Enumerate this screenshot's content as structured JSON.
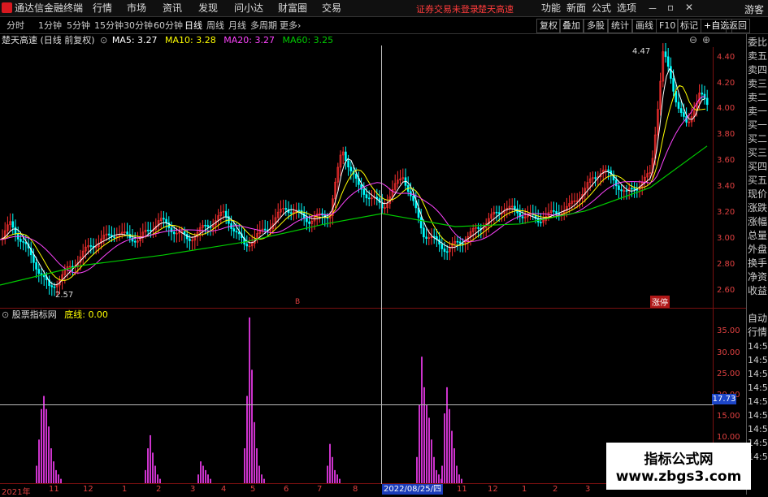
{
  "menu": {
    "app_name": "通达信金融终端",
    "items": [
      "行情",
      "市场",
      "资讯",
      "发现",
      "问小达",
      "财富圈",
      "交易"
    ],
    "trade_status": "证券交易未登录",
    "trade_status2": "楚天高速",
    "right_items": [
      "功能",
      "新面",
      "公式",
      "选项"
    ],
    "guest": "游客"
  },
  "toolbar": {
    "periods": [
      "分时",
      "1分钟",
      "5分钟",
      "15分钟",
      "30分钟",
      "60分钟",
      "日线",
      "周线",
      "月线",
      "多周期",
      "更多"
    ],
    "active_period": "日线",
    "buttons": [
      "复权",
      "叠加",
      "多股",
      "统计",
      "画线",
      "F10",
      "标记",
      "+自选",
      "返回"
    ]
  },
  "info": {
    "stock": "楚天高速",
    "mode": "(日线 前复权)",
    "ma5": "MA5: 3.27",
    "ma10": "MA10: 3.28",
    "ma20": "MA20: 3.27",
    "ma60": "MA60: 3.25"
  },
  "price_axis": [
    "4.40",
    "4.20",
    "4.00",
    "3.80",
    "3.60",
    "3.40",
    "3.20",
    "3.00",
    "2.80",
    "2.60"
  ],
  "high_label": "4.47",
  "low_label": "2.57",
  "marker_b": "B",
  "label_zhangting": "涨停",
  "indicator": {
    "title": "股票指标网",
    "line_name": "底线:",
    "line_value": "0.00",
    "axis": [
      "35.00",
      "30.00",
      "25.00",
      "20.00",
      "15.00",
      "10.00"
    ],
    "value_tag": "17.73"
  },
  "right_panel": {
    "top_labels": [
      "委比",
      "卖五",
      "卖四",
      "卖三",
      "卖二",
      "卖一",
      "买一",
      "买二",
      "买三",
      "买四",
      "买五",
      "现价",
      "涨跌",
      "涨幅",
      "总量",
      "外盘",
      "换手",
      "净资",
      "收益"
    ],
    "bottom_labels": [
      "自动",
      "行情",
      "14:50",
      "14:50",
      "14:50",
      "14:50",
      "14:50",
      "14:50",
      "14:50",
      "14:50",
      "14:50"
    ]
  },
  "dates": {
    "labels": [
      "2021年",
      "11",
      "12",
      "1",
      "2",
      "3",
      "4",
      "5",
      "6",
      "7",
      "8",
      "9",
      "10",
      "11",
      "12",
      "1",
      "2",
      "3"
    ],
    "cursor": "2022/08/25/四"
  },
  "watermark": {
    "title": "指标公式网",
    "url": "www.zbgs3.com"
  },
  "colors": {
    "up": "#ff3030",
    "down": "#00ffff",
    "ma5": "#ffffff",
    "ma10": "#ffff00",
    "ma20": "#ff44ff",
    "ma60": "#00cc00",
    "histogram": "#cc33cc"
  }
}
